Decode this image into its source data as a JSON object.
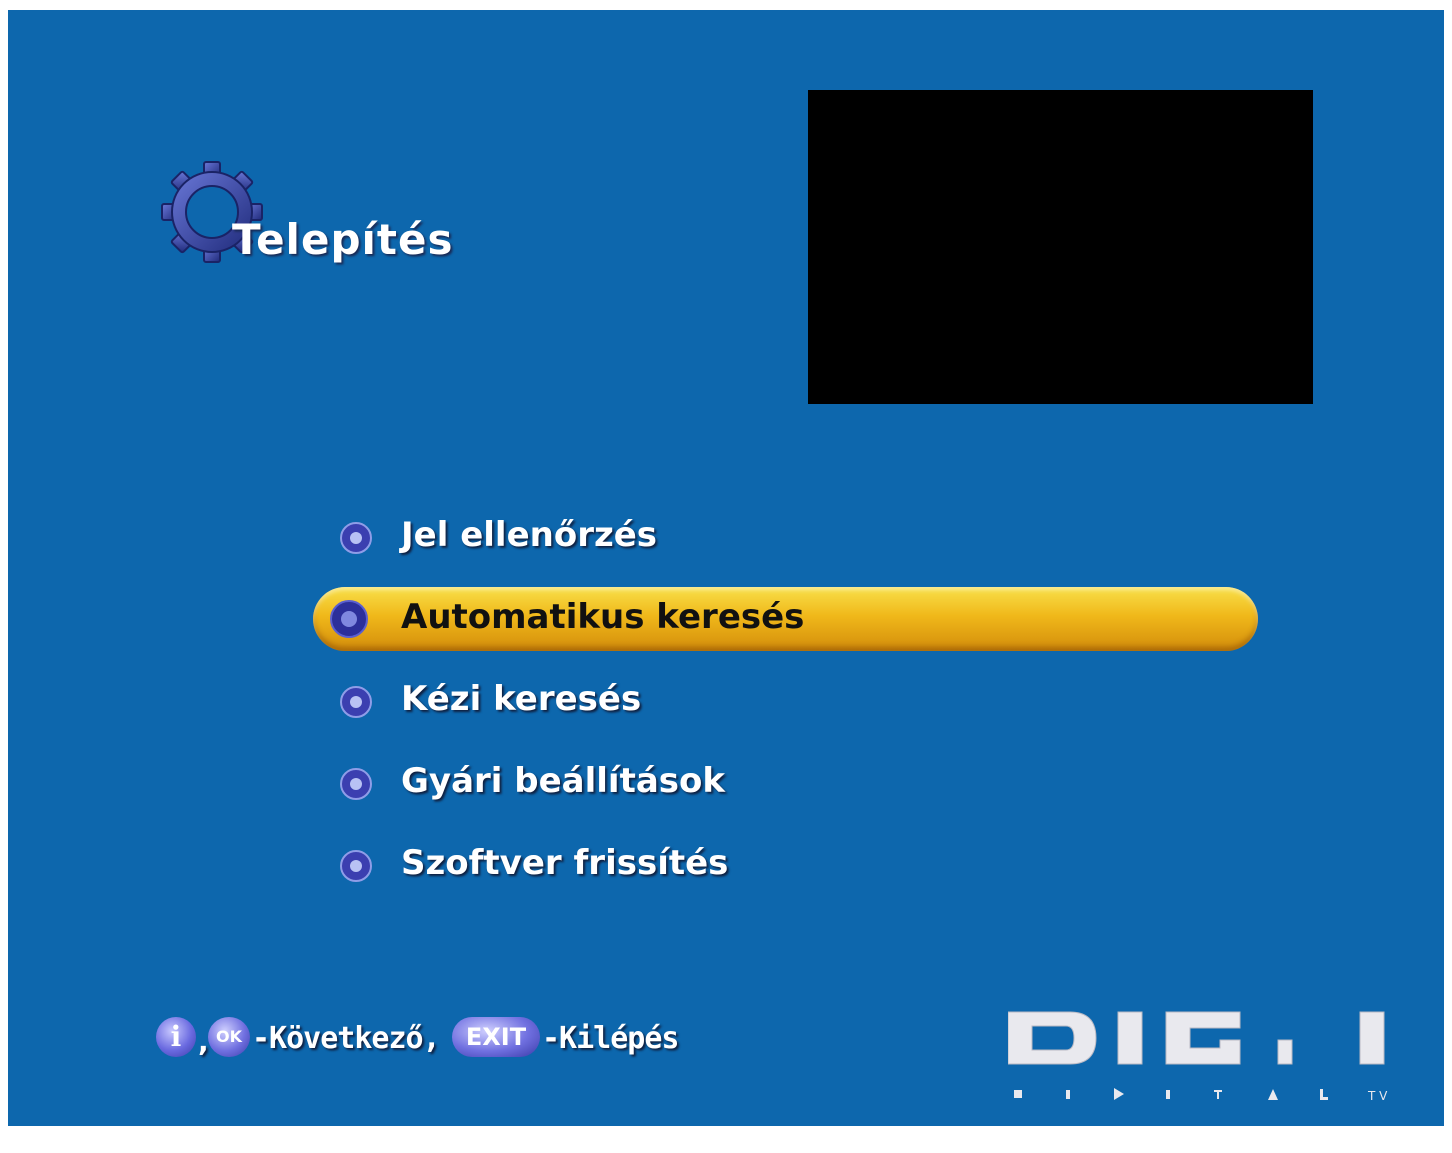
{
  "header": {
    "title": "Telepítés",
    "icon": "gear-icon"
  },
  "menu": {
    "items": [
      {
        "label": "Jel ellenőrzés",
        "selected": false
      },
      {
        "label": "Automatikus keresés",
        "selected": true
      },
      {
        "label": "Kézi keresés",
        "selected": false
      },
      {
        "label": "Gyári beállítások",
        "selected": false
      },
      {
        "label": "Szoftver frissítés",
        "selected": false
      }
    ]
  },
  "footer": {
    "info_button": "i",
    "ok_button": "OK",
    "next_text": "-Következő,",
    "exit_button": "EXIT",
    "exit_text": "-Kilépés"
  },
  "brand": {
    "logo_text": "DIGI",
    "tagline": "DIGITAL TV"
  },
  "colors": {
    "background": "#0d67ad",
    "highlight": "#f0b81a",
    "text": "#ffffff"
  }
}
